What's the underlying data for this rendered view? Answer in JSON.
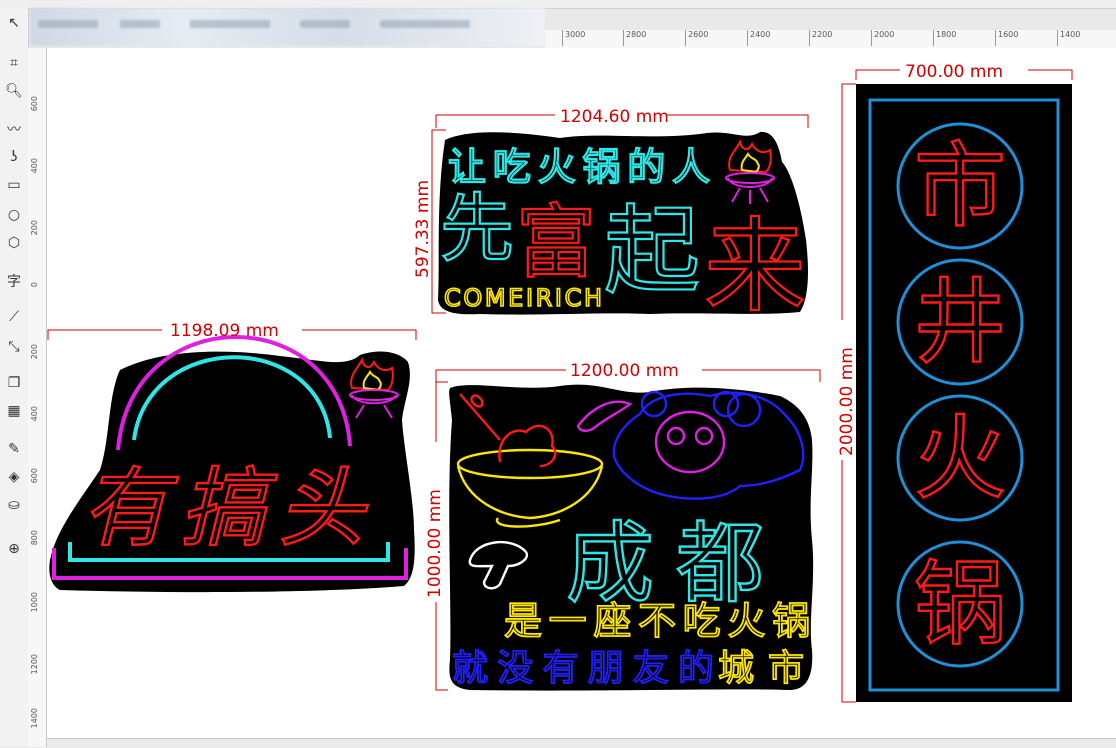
{
  "ruler": {
    "top_ticks": [
      "3000",
      "2800",
      "2600",
      "2400",
      "2200",
      "2000",
      "1800",
      "1600",
      "1400"
    ],
    "left_ticks": [
      "600",
      "400",
      "200",
      "0",
      "200",
      "400",
      "600",
      "800",
      "1000",
      "1200",
      "1400"
    ]
  },
  "tools": [
    "pick-tool",
    "crop-tool",
    "zoom-tool",
    "freehand-tool",
    "artistic-media-tool",
    "rectangle-tool",
    "ellipse-tool",
    "polygon-tool",
    "text-tool",
    "dimension-tool",
    "connector-tool",
    "drop-shadow-tool",
    "transparency-tool",
    "eyedropper-tool",
    "interactive-fill-tool",
    "smart-fill-tool",
    "add-tool"
  ],
  "dimensions": {
    "sign1_width": "1204.60 mm",
    "sign1_height": "597.33 mm",
    "sign2_width": "1198.09 mm",
    "sign3_width": "1200.00 mm",
    "sign3_height": "1000.00 mm",
    "sign4_width": "700.00 mm",
    "sign4_height": "2000.00 mm"
  },
  "sign1": {
    "line1": "让吃火锅的人",
    "big1": "先",
    "big2": "富",
    "big3": "起",
    "big4": "来",
    "brand": "COMEIRICH"
  },
  "sign2": {
    "text": "有搞头"
  },
  "sign3": {
    "title": "成都",
    "line1": "是一座不吃火锅",
    "line2a": "就没有朋友的",
    "line2b": "城市"
  },
  "sign4": {
    "chars": [
      "市",
      "井",
      "火",
      "锅"
    ]
  },
  "colors": {
    "dimension": "#d10000",
    "neon_red": "#ff1a1a",
    "neon_cyan": "#2ee6e6",
    "neon_yellow": "#ffe600",
    "neon_magenta": "#e020e0",
    "neon_blue": "#2020ff",
    "frame_blue": "#1e90d8"
  }
}
